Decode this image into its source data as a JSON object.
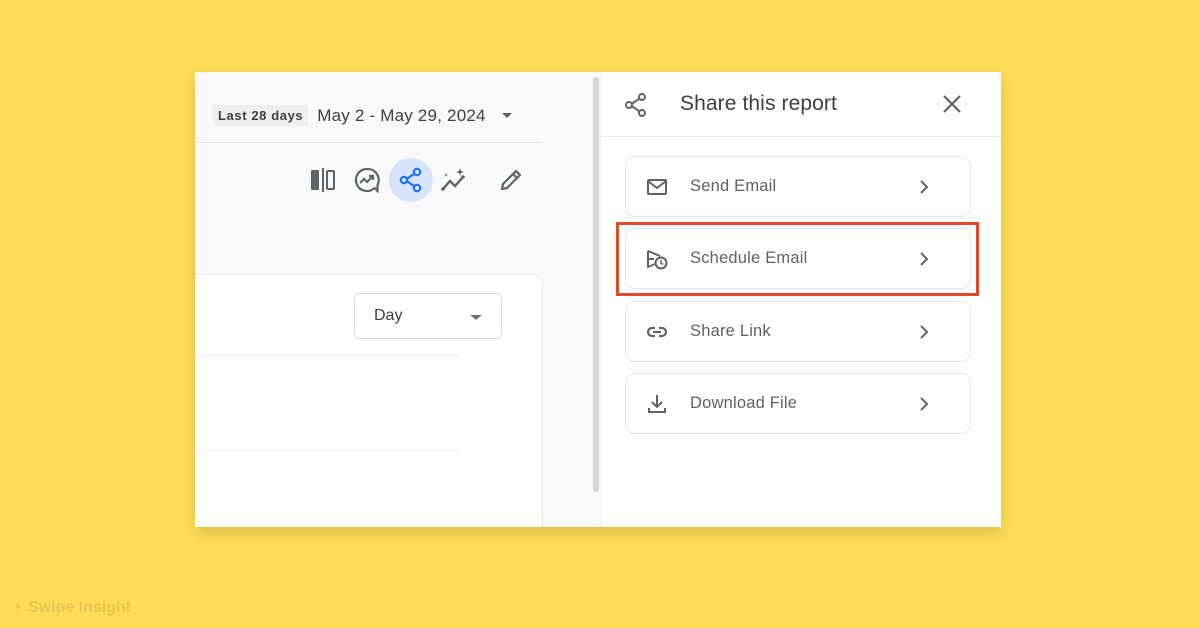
{
  "report": {
    "date_chip": "Last 28 days",
    "date_range": "May 2 - May 29, 2024",
    "toolbar": [
      {
        "name": "compare-icon",
        "active": false
      },
      {
        "name": "insights-icon",
        "active": false
      },
      {
        "name": "share-icon",
        "active": true
      },
      {
        "name": "sparkle-trend-icon",
        "active": false
      },
      {
        "name": "edit-icon",
        "active": false
      }
    ],
    "granularity_select": {
      "value": "Day"
    }
  },
  "share_panel": {
    "title": "Share this report",
    "options": [
      {
        "label": "Send Email",
        "icon": "mail-icon",
        "highlighted": false
      },
      {
        "label": "Schedule Email",
        "icon": "schedule-send-icon",
        "highlighted": true
      },
      {
        "label": "Share Link",
        "icon": "link-icon",
        "highlighted": false
      },
      {
        "label": "Download File",
        "icon": "download-icon",
        "highlighted": false
      }
    ]
  },
  "colors": {
    "background": "#FFDD59",
    "accent_active": "#1A73E8",
    "highlight_border": "#E04A2B"
  },
  "watermark": {
    "text": "Swipe Insight"
  }
}
